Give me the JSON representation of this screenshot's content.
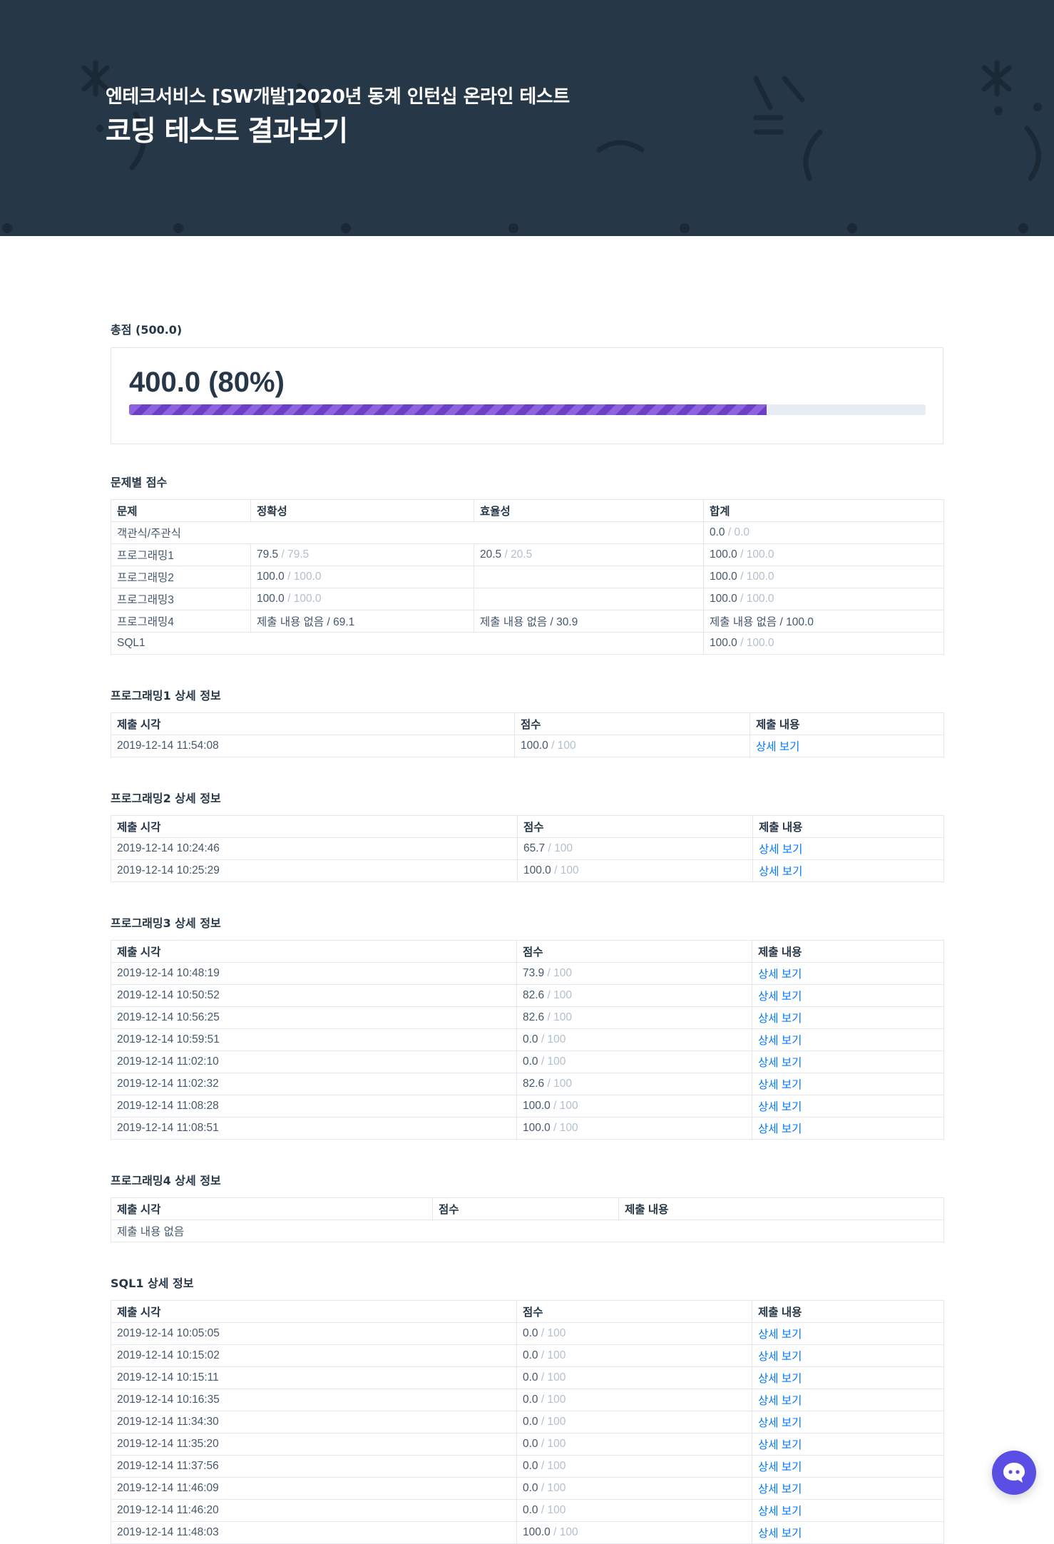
{
  "header": {
    "subtitle": "엔테크서비스 [SW개발]2020년 동계 인턴십 온라인 테스트",
    "title": "코딩 테스트 결과보기"
  },
  "total": {
    "label": "총점 (500.0)",
    "value": "400.0 (80%)",
    "progress_percent": 80
  },
  "scores": {
    "label": "문제별 점수",
    "headers": [
      "문제",
      "정확성",
      "효율성",
      "합계"
    ],
    "rows": [
      {
        "name": "객관식/주관식",
        "merged": true,
        "total": "0.0",
        "total_max": " / 0.0"
      },
      {
        "name": "프로그래밍1",
        "acc": "79.5",
        "acc_max": " / 79.5",
        "eff": "20.5",
        "eff_max": " / 20.5",
        "total": "100.0",
        "total_max": " / 100.0"
      },
      {
        "name": "프로그래밍2",
        "acc": "100.0",
        "acc_max": " / 100.0",
        "eff": "",
        "eff_max": "",
        "total": "100.0",
        "total_max": " / 100.0"
      },
      {
        "name": "프로그래밍3",
        "acc": "100.0",
        "acc_max": " / 100.0",
        "eff": "",
        "eff_max": "",
        "total": "100.0",
        "total_max": " / 100.0"
      },
      {
        "name": "프로그래밍4",
        "acc": "",
        "acc_max": "제출 내용 없음 / 69.1",
        "eff": "",
        "eff_max": "제출 내용 없음 / 30.9",
        "total": "",
        "total_max": "제출 내용 없음 / 100.0"
      },
      {
        "name": "SQL1",
        "merged": true,
        "total": "100.0",
        "total_max": " / 100.0"
      }
    ]
  },
  "details": [
    {
      "label": "프로그래밍1 상세 정보",
      "headers": [
        "제출 시각",
        "점수",
        "제출 내용"
      ],
      "rows": [
        {
          "time": "2019-12-14 11:54:08",
          "score": "100.0",
          "max": " / 100",
          "link": "상세 보기"
        }
      ]
    },
    {
      "label": "프로그래밍2 상세 정보",
      "headers": [
        "제출 시각",
        "점수",
        "제출 내용"
      ],
      "rows": [
        {
          "time": "2019-12-14 10:24:46",
          "score": "65.7",
          "max": " / 100",
          "link": "상세 보기"
        },
        {
          "time": "2019-12-14 10:25:29",
          "score": "100.0",
          "max": " / 100",
          "link": "상세 보기"
        }
      ]
    },
    {
      "label": "프로그래밍3 상세 정보",
      "headers": [
        "제출 시각",
        "점수",
        "제출 내용"
      ],
      "rows": [
        {
          "time": "2019-12-14 10:48:19",
          "score": "73.9",
          "max": " / 100",
          "link": "상세 보기"
        },
        {
          "time": "2019-12-14 10:50:52",
          "score": "82.6",
          "max": " / 100",
          "link": "상세 보기"
        },
        {
          "time": "2019-12-14 10:56:25",
          "score": "82.6",
          "max": " / 100",
          "link": "상세 보기"
        },
        {
          "time": "2019-12-14 10:59:51",
          "score": "0.0",
          "max": " / 100",
          "link": "상세 보기"
        },
        {
          "time": "2019-12-14 11:02:10",
          "score": "0.0",
          "max": " / 100",
          "link": "상세 보기"
        },
        {
          "time": "2019-12-14 11:02:32",
          "score": "82.6",
          "max": " / 100",
          "link": "상세 보기"
        },
        {
          "time": "2019-12-14 11:08:28",
          "score": "100.0",
          "max": " / 100",
          "link": "상세 보기"
        },
        {
          "time": "2019-12-14 11:08:51",
          "score": "100.0",
          "max": " / 100",
          "link": "상세 보기"
        }
      ]
    },
    {
      "label": "프로그래밍4 상세 정보",
      "headers": [
        "제출 시각",
        "점수",
        "제출 내용"
      ],
      "empty": "제출 내용 없음",
      "rows": []
    },
    {
      "label": "SQL1 상세 정보",
      "headers": [
        "제출 시각",
        "점수",
        "제출 내용"
      ],
      "rows": [
        {
          "time": "2019-12-14 10:05:05",
          "score": "0.0",
          "max": " / 100",
          "link": "상세 보기"
        },
        {
          "time": "2019-12-14 10:15:02",
          "score": "0.0",
          "max": " / 100",
          "link": "상세 보기"
        },
        {
          "time": "2019-12-14 10:15:11",
          "score": "0.0",
          "max": " / 100",
          "link": "상세 보기"
        },
        {
          "time": "2019-12-14 10:16:35",
          "score": "0.0",
          "max": " / 100",
          "link": "상세 보기"
        },
        {
          "time": "2019-12-14 11:34:30",
          "score": "0.0",
          "max": " / 100",
          "link": "상세 보기"
        },
        {
          "time": "2019-12-14 11:35:20",
          "score": "0.0",
          "max": " / 100",
          "link": "상세 보기"
        },
        {
          "time": "2019-12-14 11:37:56",
          "score": "0.0",
          "max": " / 100",
          "link": "상세 보기"
        },
        {
          "time": "2019-12-14 11:46:09",
          "score": "0.0",
          "max": " / 100",
          "link": "상세 보기"
        },
        {
          "time": "2019-12-14 11:46:20",
          "score": "0.0",
          "max": " / 100",
          "link": "상세 보기"
        },
        {
          "time": "2019-12-14 11:48:03",
          "score": "100.0",
          "max": " / 100",
          "link": "상세 보기"
        }
      ]
    }
  ],
  "colors": {
    "header_bg": "#263747",
    "progress": "#6c3fc4",
    "link": "#0078ff",
    "muted": "#b2c0cc",
    "chat_button": "#5b4ee4"
  },
  "icons": {
    "chat": "chat-bubble-icon"
  }
}
